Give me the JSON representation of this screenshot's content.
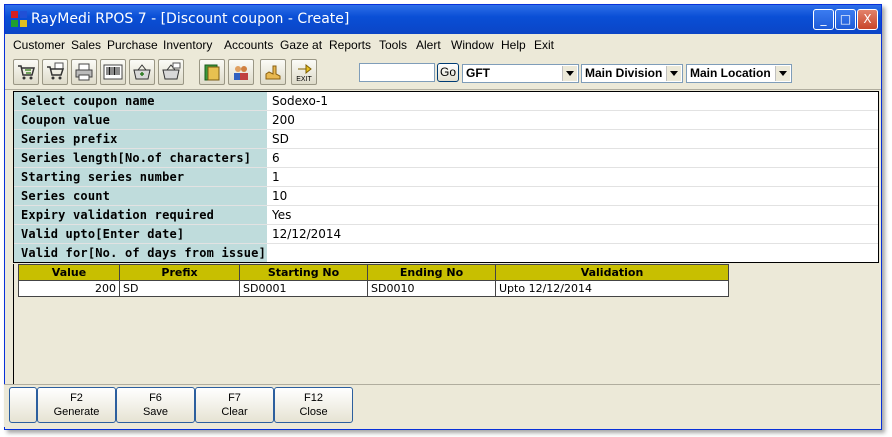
{
  "window": {
    "title": "RayMedi RPOS 7 - [Discount coupon - Create]",
    "controls": [
      "_",
      "□",
      "X"
    ]
  },
  "menu": [
    "Customer",
    "Sales",
    "Purchase",
    "Inventory",
    "Accounts",
    "Gaze at",
    "Reports",
    "Tools",
    "Alert",
    "Window",
    "Help",
    "Exit"
  ],
  "toolbar": {
    "tools": [
      "cart-icon",
      "cart-list-icon",
      "printer-icon",
      "barcode-icon",
      "basket-add-icon",
      "basket-list-icon",
      "book-icon",
      "people-icon",
      "hand-icon",
      "exit-icon"
    ],
    "exit_label": "EXIT",
    "search_value": "",
    "go_label": "Go",
    "type_select": "GFT",
    "division_select": "Main Division",
    "location_select": "Main Location"
  },
  "form": {
    "rows": [
      {
        "label": "Select coupon name",
        "value": "Sodexo-1"
      },
      {
        "label": "Coupon value",
        "value": "200"
      },
      {
        "label": "Series prefix",
        "value": "SD"
      },
      {
        "label": "Series length[No.of characters]",
        "value": "6"
      },
      {
        "label": "Starting series number",
        "value": "1"
      },
      {
        "label": "Series count",
        "value": "10"
      },
      {
        "label": "Expiry validation required",
        "value": "Yes"
      },
      {
        "label": "Valid upto[Enter date]",
        "value": "12/12/2014"
      },
      {
        "label": "Valid for[No. of days from issue]",
        "value": ""
      }
    ]
  },
  "grid": {
    "headers": [
      "Value",
      "Prefix",
      "Starting No",
      "Ending No",
      "Validation"
    ],
    "rows": [
      [
        "200",
        "SD",
        "SD0001",
        "SD0010",
        "Upto 12/12/2014"
      ]
    ]
  },
  "footer": {
    "keys": [
      {
        "key": "F2",
        "label": "Generate"
      },
      {
        "key": "F6",
        "label": "Save"
      },
      {
        "key": "F7",
        "label": "Clear"
      },
      {
        "key": "F12",
        "label": "Close"
      }
    ]
  },
  "colors": {
    "titlebar": "#0a4fd6",
    "label_bg": "#bfdcdc",
    "grid_header": "#c8bf00",
    "window_bg": "#ece9d8"
  }
}
